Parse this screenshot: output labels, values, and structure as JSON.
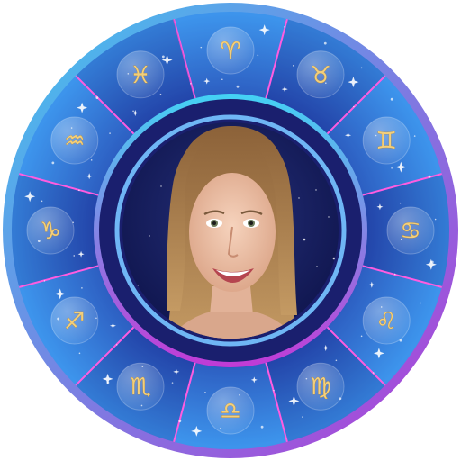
{
  "wheel": {
    "colors": {
      "outer_ring_start": "#3ec7ef",
      "outer_ring_end": "#b43ad6",
      "segment_light": "#3a8fe8",
      "segment_dark": "#1d2f9c",
      "divider": "#ff5ce0",
      "inner_ring_light": "#43d3f4",
      "inner_ring_dark": "#c23ad6",
      "starfield": "#10164f",
      "glyph_gold": "#f2cf7c"
    },
    "signs": [
      {
        "name": "aries",
        "icon": "aries-icon",
        "glyph": "♈"
      },
      {
        "name": "taurus",
        "icon": "taurus-icon",
        "glyph": "♉"
      },
      {
        "name": "gemini",
        "icon": "gemini-icon",
        "glyph": "♊"
      },
      {
        "name": "cancer",
        "icon": "cancer-icon",
        "glyph": "♋"
      },
      {
        "name": "leo",
        "icon": "leo-icon",
        "glyph": "♌"
      },
      {
        "name": "virgo",
        "icon": "virgo-icon",
        "glyph": "♍"
      },
      {
        "name": "libra",
        "icon": "libra-icon",
        "glyph": "♎"
      },
      {
        "name": "scorpio",
        "icon": "scorpio-icon",
        "glyph": "♏"
      },
      {
        "name": "sagittarius",
        "icon": "sagittarius-icon",
        "glyph": "♐"
      },
      {
        "name": "capricorn",
        "icon": "capricorn-icon",
        "glyph": "♑"
      },
      {
        "name": "aquarius",
        "icon": "aquarius-icon",
        "glyph": "♒"
      },
      {
        "name": "pisces",
        "icon": "pisces-icon",
        "glyph": "♓"
      }
    ],
    "portrait": {
      "subject": "smiling-woman-portrait"
    }
  }
}
